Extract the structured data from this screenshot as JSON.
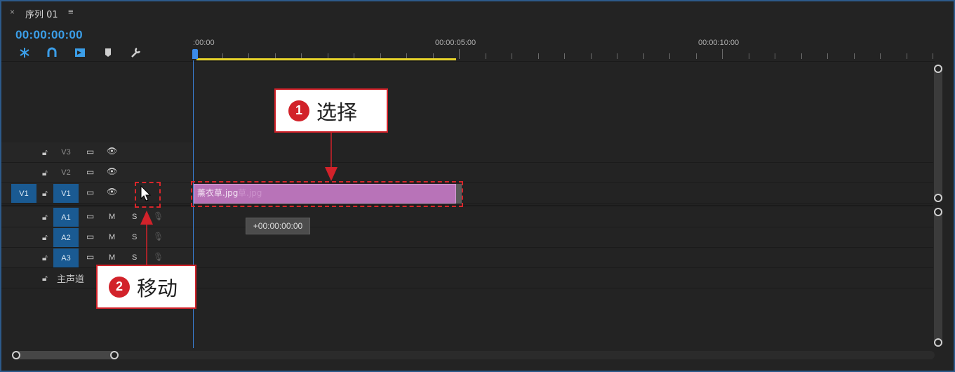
{
  "panel": {
    "close": "×",
    "title": "序列 01",
    "menu": "≡"
  },
  "timecode": "00:00:00:00",
  "tools": [
    {
      "icon": "snap-icon"
    },
    {
      "icon": "linked-selection-icon"
    },
    {
      "icon": "insert-overwrite-icon"
    },
    {
      "icon": "marker-icon"
    },
    {
      "icon": "wrench-icon"
    }
  ],
  "ruler": {
    "labels": [
      ":00:00",
      "00:00:05:00",
      "00:00:10:00"
    ]
  },
  "tracks": {
    "video": [
      {
        "name": "V3",
        "source": ""
      },
      {
        "name": "V2",
        "source": ""
      },
      {
        "name": "V1",
        "source": "V1"
      }
    ],
    "audio": [
      {
        "name": "A1",
        "m": "M",
        "s": "S"
      },
      {
        "name": "A2",
        "m": "M",
        "s": "S"
      },
      {
        "name": "A3",
        "m": "M",
        "s": "S"
      }
    ],
    "master": "主声道"
  },
  "clip": {
    "name": "薰衣草.jpg",
    "ghost": "草.jpg"
  },
  "tooltip": "+00:00:00:00",
  "callouts": [
    {
      "num": "1",
      "text": "选择"
    },
    {
      "num": "2",
      "text": "移动"
    }
  ],
  "colors": {
    "accent": "#3b9ee8",
    "clip": "#b873b8",
    "annotation": "#d2222a",
    "workarea": "#e6d22a"
  }
}
